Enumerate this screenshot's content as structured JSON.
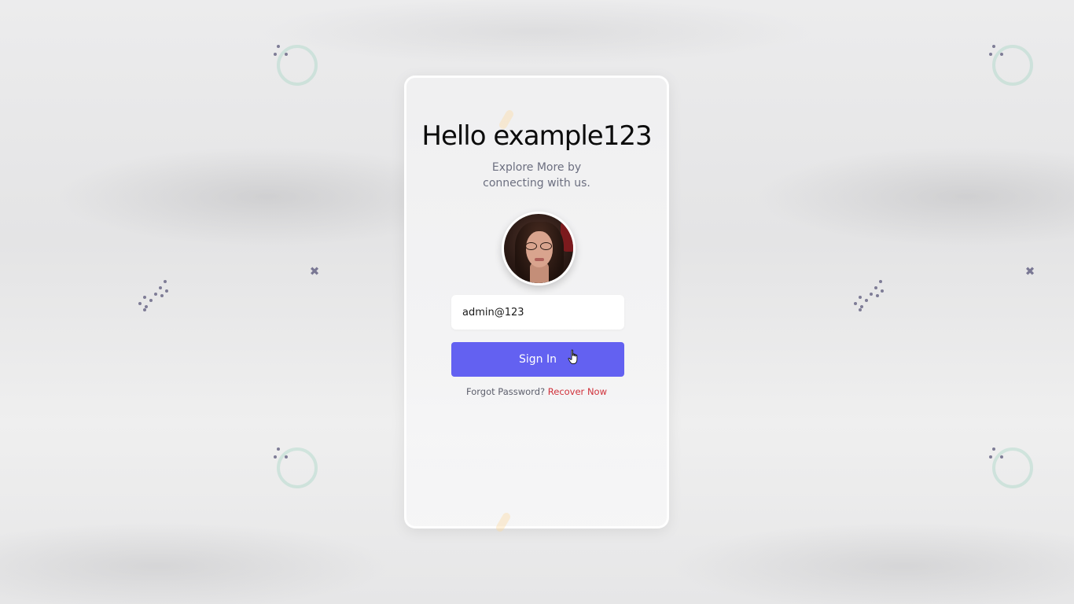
{
  "card": {
    "title": "Hello example123",
    "subtitle": "Explore More by connecting with us.",
    "username_value": "admin@123",
    "sign_in_label": "Sign In",
    "forgot_text": "Forgot Password?",
    "recover_link": "Recover Now"
  },
  "colors": {
    "accent": "#6361f1",
    "link": "#d0313a",
    "background": "#e9e9ea"
  },
  "icons": {
    "cursor": "hand-pointer-icon",
    "cross": "x-mark-icon"
  }
}
